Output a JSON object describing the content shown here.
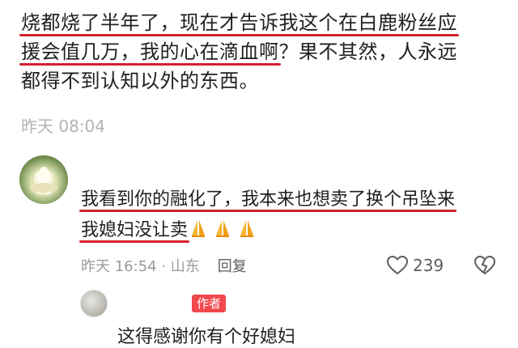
{
  "post": {
    "lines": [
      [
        "烧都烧了半年了，",
        "现在才告诉我这个在白鹿粉丝应"
      ],
      [
        "援会值几万，",
        "我的心在滴血啊",
        "？果不其然，人永远"
      ],
      [
        "都得不到认知以外的东西。"
      ]
    ],
    "time": "昨天 08:04"
  },
  "comment": {
    "line1_hl_a": "我看到你的融化了，",
    "line1_hl_b": "我本来也想卖了换个吊坠来",
    "line2_hl": "我媳妇没让卖",
    "time_location": "昨天 16:54 · 山东",
    "reply_label": "回复",
    "like_count": "239",
    "emoji_name": "folded-hands-icon",
    "accent": "#d2222f"
  },
  "sub_comment": {
    "badge": "作者",
    "text": "这得感谢你有个好媳妇"
  }
}
